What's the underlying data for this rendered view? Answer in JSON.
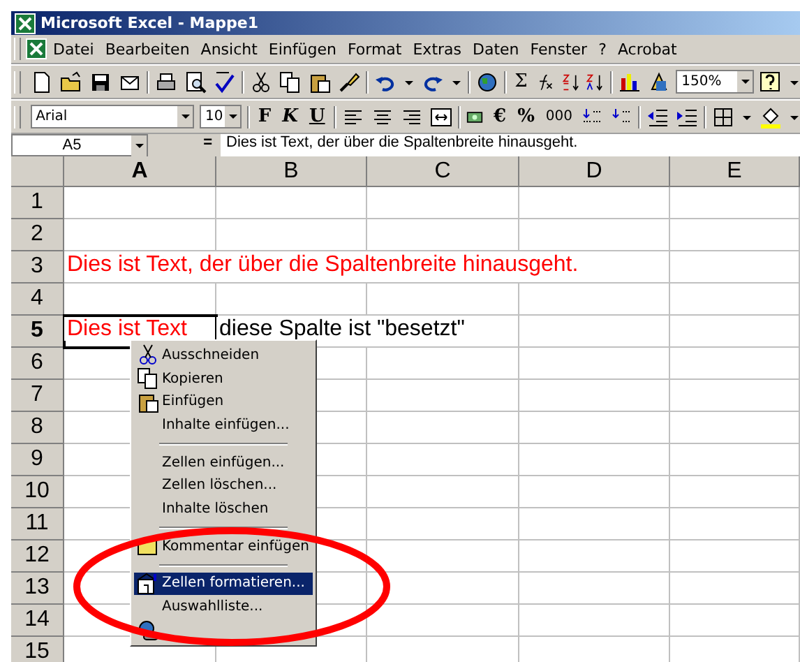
{
  "window": {
    "title": "Microsoft Excel - Mappe1"
  },
  "menu_bar": [
    {
      "label": "Datei"
    },
    {
      "label": "Bearbeiten"
    },
    {
      "label": "Ansicht"
    },
    {
      "label": "Einfügen"
    },
    {
      "label": "Format"
    },
    {
      "label": "Extras"
    },
    {
      "label": "Daten"
    },
    {
      "label": "Fenster"
    },
    {
      "label": "?"
    },
    {
      "label": "Acrobat"
    }
  ],
  "standard_toolbar": {
    "sum": "Σ",
    "zoom": "150%"
  },
  "formatting_toolbar": {
    "font": "Arial",
    "size": "10",
    "bold": "F",
    "italic": "K",
    "underline": "U",
    "euro": "€",
    "percent": "%",
    "thousands": "000"
  },
  "formula_bar": {
    "name_box": "A5",
    "equals": "=",
    "content": "Dies ist Text, der über die Spaltenbreite hinausgeht."
  },
  "sheet": {
    "columns": [
      {
        "label": "A",
        "selected": true
      },
      {
        "label": "B",
        "selected": false
      },
      {
        "label": "C",
        "selected": false
      },
      {
        "label": "D",
        "selected": false
      },
      {
        "label": "E",
        "selected": false
      }
    ],
    "rows": [
      {
        "label": "1",
        "selected": false,
        "cells": []
      },
      {
        "label": "2",
        "selected": false,
        "cells": []
      },
      {
        "label": "3",
        "selected": false,
        "cells": [
          {
            "text": "Dies ist Text, der über die Spaltenbreite hinausgeht.",
            "color": "#ff0000"
          }
        ]
      },
      {
        "label": "4",
        "selected": false,
        "cells": []
      },
      {
        "label": "5",
        "selected": true,
        "cells": [
          {
            "text": "Dies ist Text",
            "color": "#ff0000"
          },
          {
            "text": "diese Spalte ist \"besetzt\"",
            "color": "#000000"
          }
        ]
      },
      {
        "label": "6",
        "selected": false,
        "cells": []
      },
      {
        "label": "7",
        "selected": false,
        "cells": []
      },
      {
        "label": "8",
        "selected": false,
        "cells": []
      },
      {
        "label": "9",
        "selected": false,
        "cells": []
      },
      {
        "label": "10",
        "selected": false,
        "cells": []
      },
      {
        "label": "11",
        "selected": false,
        "cells": []
      },
      {
        "label": "12",
        "selected": false,
        "cells": []
      },
      {
        "label": "13",
        "selected": false,
        "cells": []
      },
      {
        "label": "14",
        "selected": false,
        "cells": []
      },
      {
        "label": "15",
        "selected": false,
        "cells": []
      }
    ]
  },
  "context_menu": {
    "items": [
      {
        "kind": "item",
        "label": "Ausschneiden",
        "selected": false
      },
      {
        "kind": "item",
        "label": "Kopieren",
        "selected": false
      },
      {
        "kind": "item",
        "label": "Einfügen",
        "selected": false
      },
      {
        "kind": "item",
        "label": "Inhalte einfügen...",
        "selected": false
      },
      {
        "kind": "separator"
      },
      {
        "kind": "item",
        "label": "Zellen einfügen...",
        "selected": false
      },
      {
        "kind": "item",
        "label": "Zellen löschen...",
        "selected": false
      },
      {
        "kind": "item",
        "label": "Inhalte löschen",
        "selected": false
      },
      {
        "kind": "separator"
      },
      {
        "kind": "item",
        "label": "Kommentar einfügen",
        "selected": false
      },
      {
        "kind": "separator"
      },
      {
        "kind": "item",
        "label": "Zellen formatieren...",
        "selected": true
      },
      {
        "kind": "item",
        "label": "Auswahlliste...",
        "selected": false
      },
      {
        "kind": "covered"
      }
    ]
  },
  "annotation": {
    "kind": "ellipse",
    "color": "#ff0000"
  }
}
